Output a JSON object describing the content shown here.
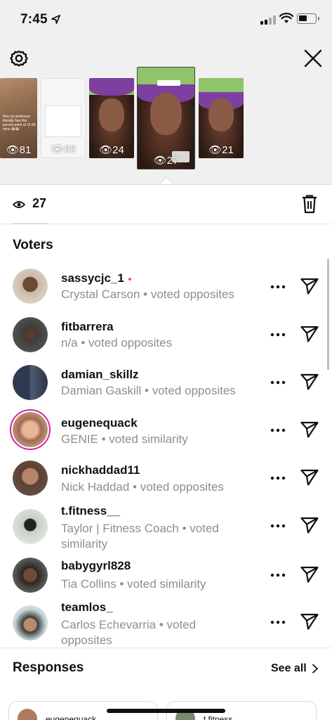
{
  "status_bar": {
    "time": "7:45",
    "icons": [
      "location-arrow-icon",
      "cellular-signal-icon",
      "wifi-icon",
      "battery-icon"
    ]
  },
  "header": {
    "settings_icon": "gear-icon",
    "close_icon": "close-icon"
  },
  "stories": [
    {
      "views": "81",
      "caption": "Hey my professor literally has this person point at 11:45 mins 😂😂"
    },
    {
      "views": "68"
    },
    {
      "views": "24"
    },
    {
      "views": "27",
      "selected": true
    },
    {
      "views": "21"
    }
  ],
  "view_bar": {
    "count": "27",
    "eye_icon": "eye-icon",
    "delete_icon": "trash-icon"
  },
  "voters_title": "Voters",
  "voters": [
    {
      "username": "sassycjc_1",
      "unread": true,
      "sub": "Crystal Carson • voted opposites"
    },
    {
      "username": "fitbarrera",
      "sub": "n/a • voted opposites"
    },
    {
      "username": "damian_skillz",
      "sub": "Damian Gaskill • voted opposites"
    },
    {
      "username": "eugenequack",
      "has_story": true,
      "sub": "GENIE • voted similarity"
    },
    {
      "username": "nickhaddad11",
      "sub": "Nick Haddad • voted opposites"
    },
    {
      "username": "t.fitness__",
      "sub": "Taylor | Fitness Coach • voted similarity"
    },
    {
      "username": "babygyrl828",
      "sub": "Tia Collins • voted similarity"
    },
    {
      "username": "teamlos_",
      "sub": "Carlos Echevarria • voted opposites"
    }
  ],
  "responses": {
    "title": "Responses",
    "see_all": "See all",
    "cards": [
      "eugenequack",
      "t.fitness__"
    ]
  },
  "colors": {
    "accent_red": "#ed4956",
    "story_ring": "#d6249f",
    "secondary_text": "#8e8e8e",
    "bg_top": "#f0f0f0"
  }
}
